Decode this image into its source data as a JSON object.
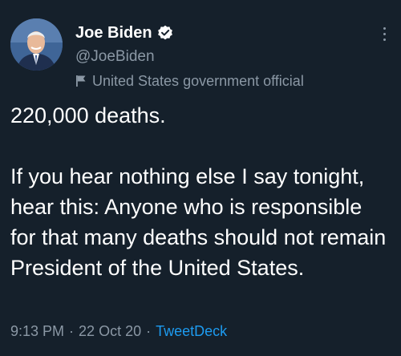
{
  "tweet": {
    "author_name": "Joe Biden",
    "handle": "@JoeBiden",
    "account_label": "United States government official",
    "text": "220,000 deaths.\n\nIf you hear nothing else I say tonight, hear this: Anyone who is responsible for that many deaths should not remain President of the United States.",
    "time": "9:13 PM",
    "date": "22 Oct 20",
    "source": "TweetDeck",
    "separator": "·"
  },
  "icons": {
    "verified": "verified-badge-icon",
    "label_flag": "flag-icon",
    "more": "more-options-icon"
  },
  "colors": {
    "background": "#15202b",
    "text": "#ffffff",
    "secondary": "#8b98a5",
    "link": "#1d9bf0"
  }
}
